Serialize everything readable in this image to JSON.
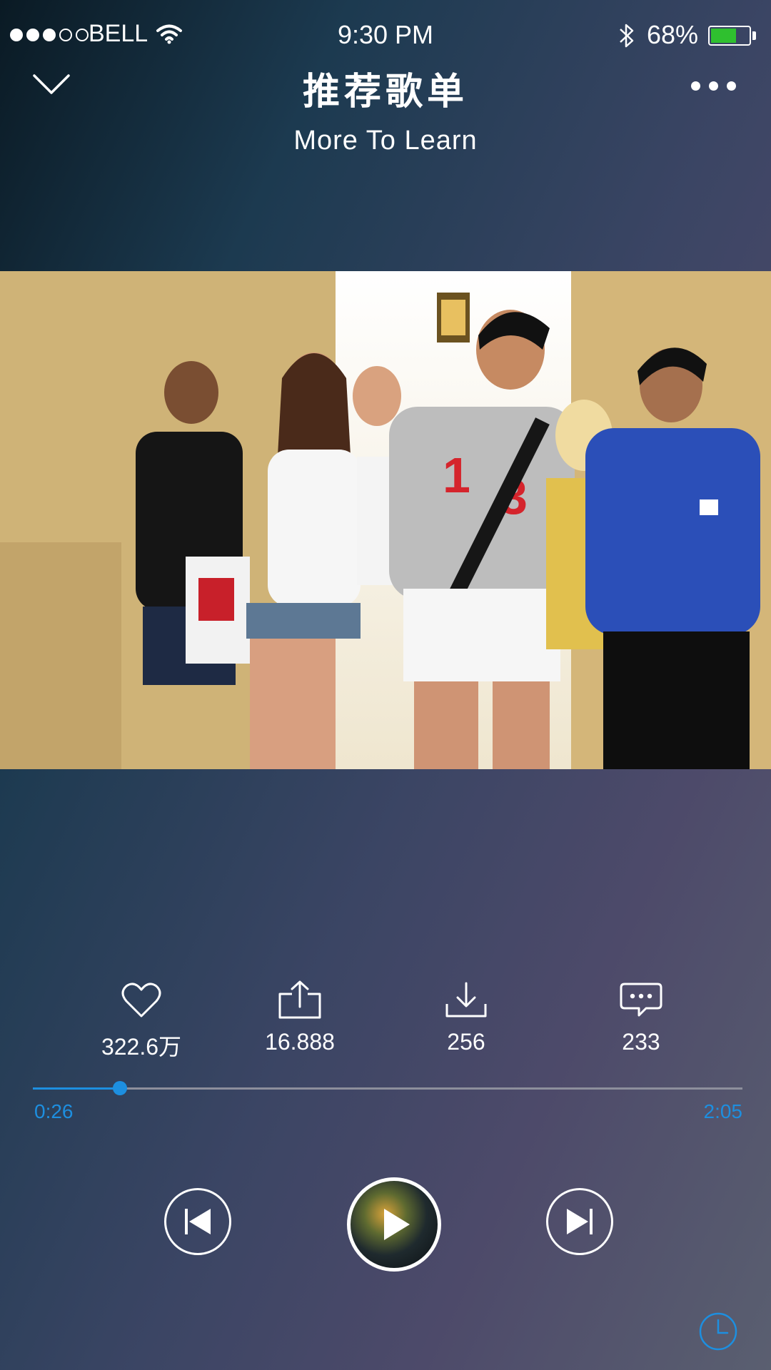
{
  "status_bar": {
    "carrier": "BELL",
    "time": "9:30 PM",
    "battery_percent": "68%",
    "battery_level": 0.68,
    "signal_bars": 3,
    "signal_total": 5,
    "battery_color": "#2fc02f"
  },
  "header": {
    "title": "推荐歌单",
    "subtitle": "More To Learn"
  },
  "actions": {
    "like_count": "322.6万",
    "share_count": "16.888",
    "download_count": "256",
    "comment_count": "233"
  },
  "player": {
    "elapsed": "0:26",
    "duration": "2:05",
    "progress": 0.123,
    "accent_color": "#1d8fe0"
  },
  "icons": {
    "back": "chevron-down-icon",
    "more": "more-dots-icon",
    "like": "heart-icon",
    "share": "share-icon",
    "download": "download-icon",
    "comment": "comment-icon",
    "prev": "skip-previous-icon",
    "play": "play-icon",
    "next": "skip-next-icon",
    "timer": "clock-icon"
  }
}
